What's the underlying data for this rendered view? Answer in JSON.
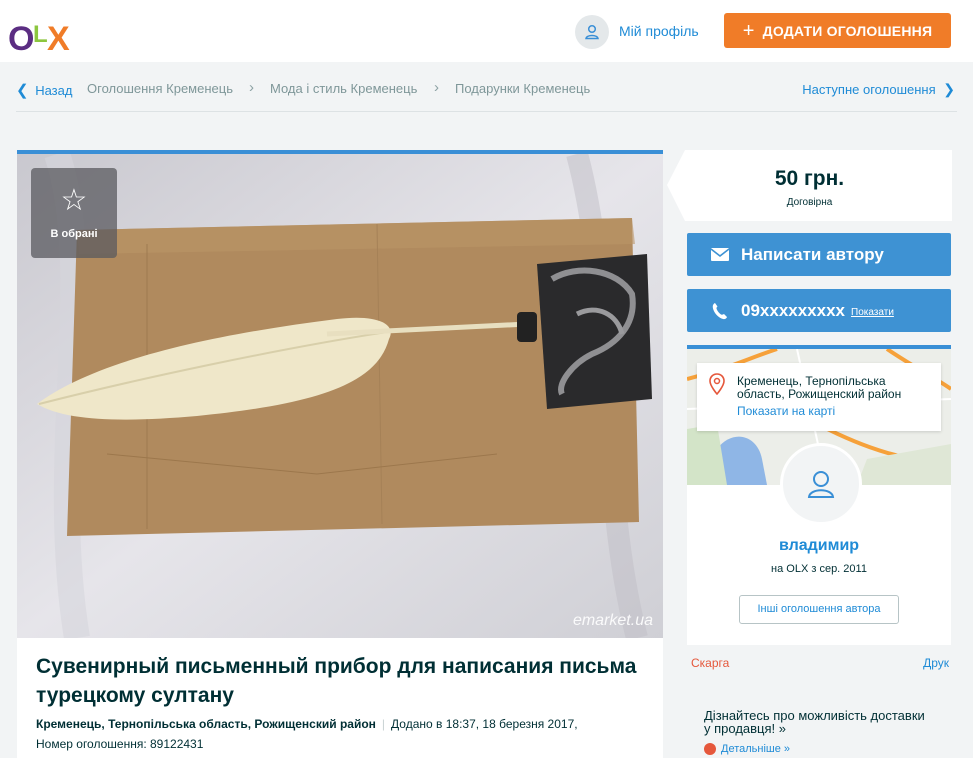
{
  "header": {
    "logo_text": "OLX",
    "profile_label": "Мій профіль",
    "add_button_label": "ДОДАТИ ОГОЛОШЕННЯ"
  },
  "breadcrumbs": {
    "back_label": "Назад",
    "items": [
      "Оголошення Кременець",
      "Мода і стиль Кременець",
      "Подарунки Кременець"
    ],
    "next_label": "Наступне оголошення"
  },
  "photo": {
    "favorite_label": "В обрані",
    "watermark": "emarket.ua"
  },
  "listing": {
    "title": "Сувенирный письменный прибор для написания письма турецкому султану",
    "location": "Кременець, Тернопільська область, Рожищенский район",
    "added": "Додано в 18:37, 18 березня 2017,",
    "ad_number": "Номер оголошення: 89122431"
  },
  "price": {
    "value": "50 грн.",
    "note": "Договірна"
  },
  "contact": {
    "write_label": "Написати автору",
    "phone_masked": "09xxxxxxxxx",
    "show_label": "Показати"
  },
  "seller": {
    "location": "Кременець, Тернопільська область, Рожищенский район",
    "map_link": "Показати на карті",
    "name": "владимир",
    "since": "на OLX з сер. 2011",
    "other_ads_label": "Інші оголошення автора"
  },
  "actions": {
    "report_label": "Скарга",
    "print_label": "Друк"
  },
  "delivery": {
    "text": "Дізнайтесь про можливість доставки у продавця! »",
    "link_label": "Детальніше »"
  },
  "colors": {
    "accent_orange": "#f07c28",
    "accent_blue": "#3e92d3",
    "link_blue": "#1f8bd6",
    "report_red": "#e5573b"
  }
}
